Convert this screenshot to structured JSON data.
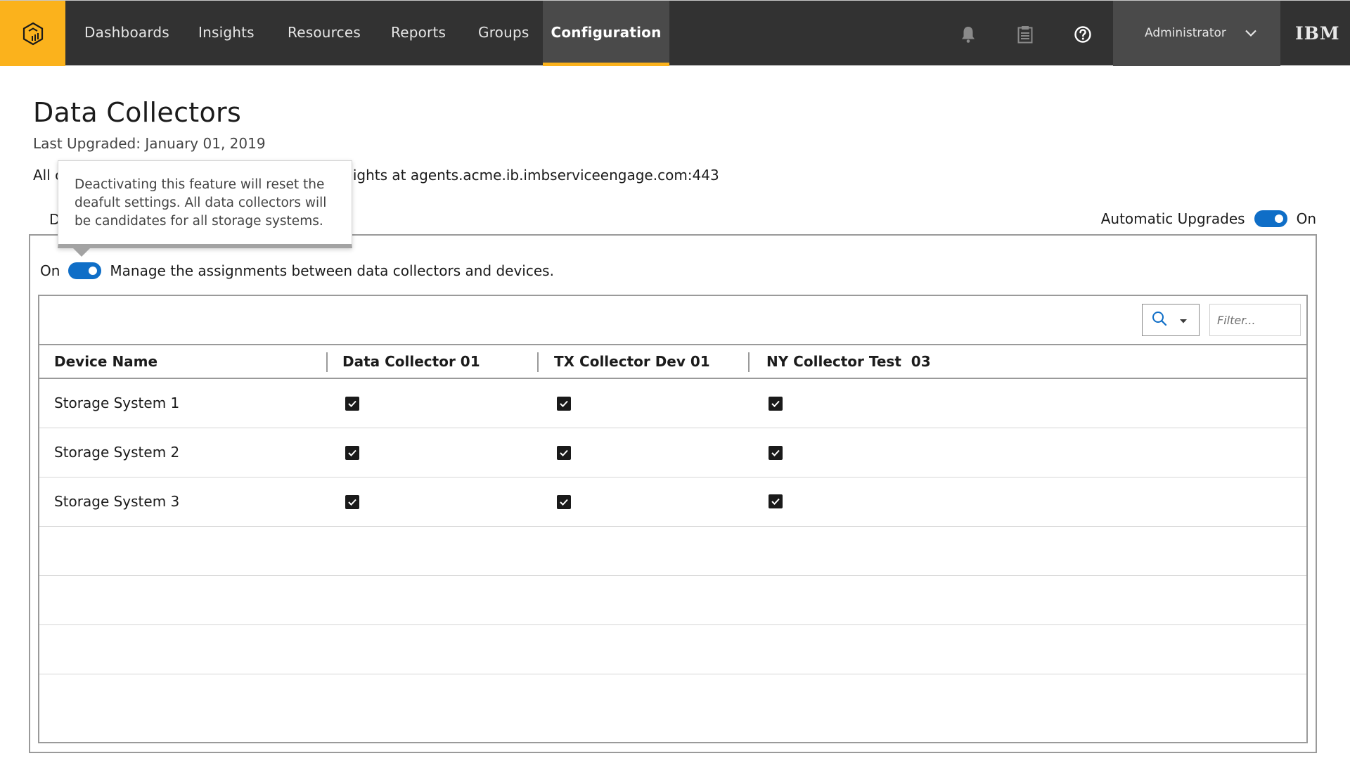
{
  "nav": {
    "items": [
      {
        "label": "Dashboards"
      },
      {
        "label": "Insights"
      },
      {
        "label": "Resources"
      },
      {
        "label": "Reports"
      },
      {
        "label": "Groups"
      },
      {
        "label": "Configuration",
        "active": true
      }
    ],
    "user": "Administrator",
    "brand": "IBM",
    "icons": [
      "bell-icon",
      "clipboard-icon",
      "help-icon",
      "chevron-down-icon"
    ],
    "accent_color": "#fbb21c"
  },
  "page": {
    "title": "Data Collectors",
    "subtitle": "Last Upgraded: January 01, 2019",
    "info_visible_start": "All c",
    "info_visible_end": "Insights at agents.acme.ib.imbserviceengage.com:443",
    "section_label_fragment": "D"
  },
  "auto_upgrades": {
    "label": "Automatic Upgrades",
    "state": "On"
  },
  "assignment": {
    "state": "On",
    "label": "Manage the assignments between data collectors and devices."
  },
  "tooltip": {
    "text": "Deactivating this feature will reset the deafult settings. All data collectors will be candidates for all storage systems."
  },
  "toolbar": {
    "filter_placeholder": "Filter..."
  },
  "table": {
    "columns": [
      "Device Name",
      "Data Collector 01",
      "TX Collector Dev 01",
      "NY Collector Test  03"
    ],
    "rows": [
      {
        "name": "Storage System 1",
        "checks": [
          true,
          true,
          true
        ]
      },
      {
        "name": "Storage System 2",
        "checks": [
          true,
          true,
          true
        ]
      },
      {
        "name": "Storage System 3",
        "checks": [
          true,
          true,
          true
        ]
      }
    ],
    "empty_rows": 4
  },
  "colors": {
    "toggle_on": "#0f6ec7",
    "nav_bg": "#323232"
  }
}
